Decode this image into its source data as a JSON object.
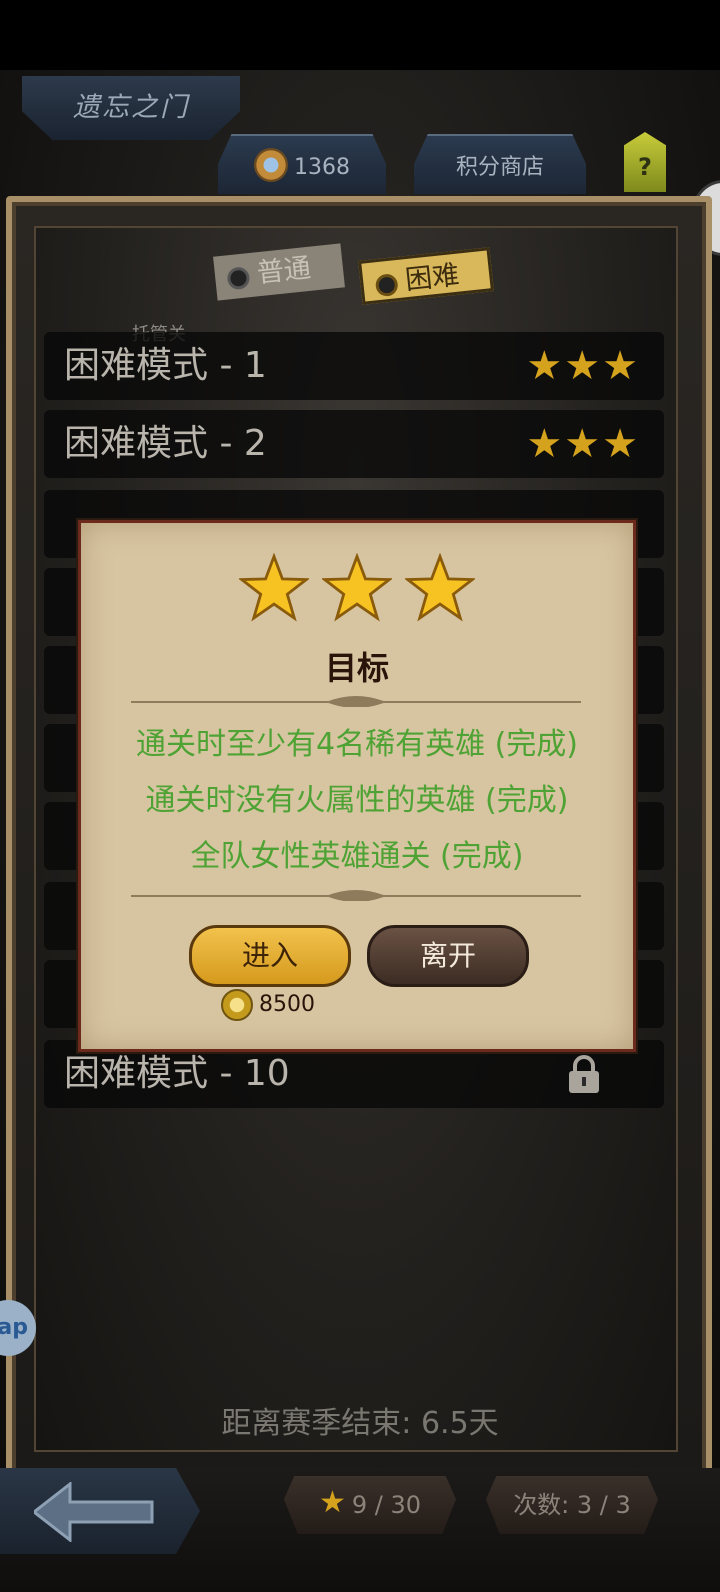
{
  "header": {
    "title": "遗忘之门",
    "points": "1368",
    "shop_label": "积分商店",
    "help_label": "?"
  },
  "mode_tabs": [
    {
      "label": "普通",
      "active": false
    },
    {
      "label": "困难",
      "active": true
    }
  ],
  "auto_label": "托管关",
  "levels": [
    {
      "label": "困难模式 - 1",
      "stars": 3
    },
    {
      "label": "困难模式 - 2",
      "stars": 3
    },
    {
      "label": "困难模式 - 10",
      "locked": true
    }
  ],
  "dialog": {
    "stars": 3,
    "title": "目标",
    "objectives": [
      "通关时至少有4名稀有英雄 (完成)",
      "通关时没有火属性的英雄 (完成)",
      "全队女性英雄通关 (完成)"
    ],
    "enter_label": "进入",
    "leave_label": "离开",
    "cost": "8500"
  },
  "footer": {
    "season_text": "距离赛季结束: 6.5天",
    "stars_progress": "9 / 30",
    "attempts": "次数: 3 / 3"
  },
  "side_app_label": "ap",
  "colors": {
    "objective_green": "#4ea334",
    "gold": "#d4a21c",
    "dialog_bg": "#d7c5a2"
  }
}
